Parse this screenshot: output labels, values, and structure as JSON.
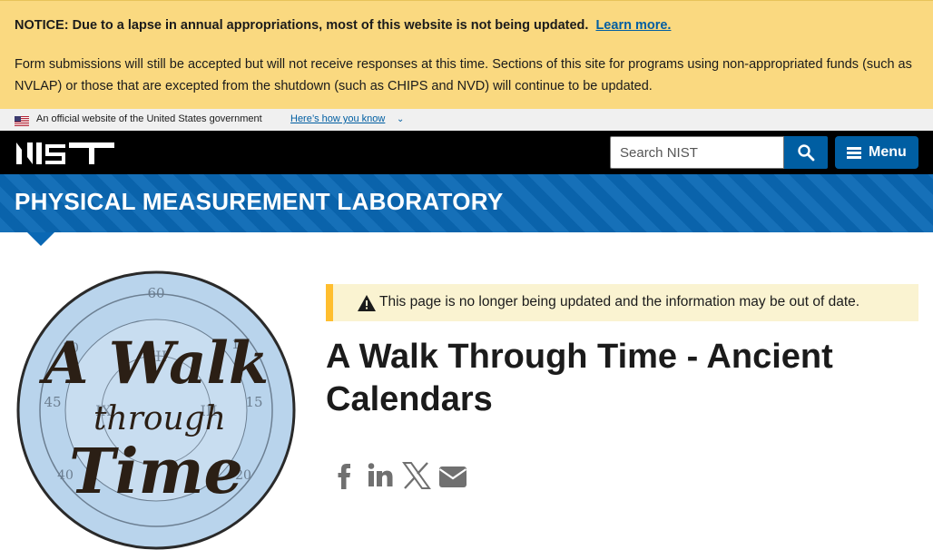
{
  "notice": {
    "lead": "NOTICE: Due to a lapse in annual appropriations, most of this website is not being updated.",
    "link": "Learn more.",
    "body": "Form submissions will still be accepted but will not receive responses at this time. Sections of this site for programs using non-appropriated funds (such as NVLAP) or those that are excepted from the shutdown (such as CHIPS and NVD) will continue to be updated."
  },
  "govbar": {
    "official": "An official website of the United States government",
    "how": "Here’s how you know"
  },
  "header": {
    "logo": "NIST",
    "search_placeholder": "Search NIST",
    "menu_label": "Menu"
  },
  "banner": {
    "title": "PHYSICAL MEASUREMENT LABORATORY"
  },
  "image": {
    "title_art": "A Walk through Time"
  },
  "alert": {
    "message": "This page is no longer being updated and the information may be out of date."
  },
  "page": {
    "title": "A Walk Through Time - Ancient Calendars"
  },
  "share": [
    "facebook-icon",
    "linkedin-icon",
    "x-icon",
    "email-icon"
  ],
  "colors": {
    "accent": "#005ea2",
    "banner": "#0a68b4",
    "notice": "#fad980",
    "alert_border": "#ffbe2e"
  }
}
